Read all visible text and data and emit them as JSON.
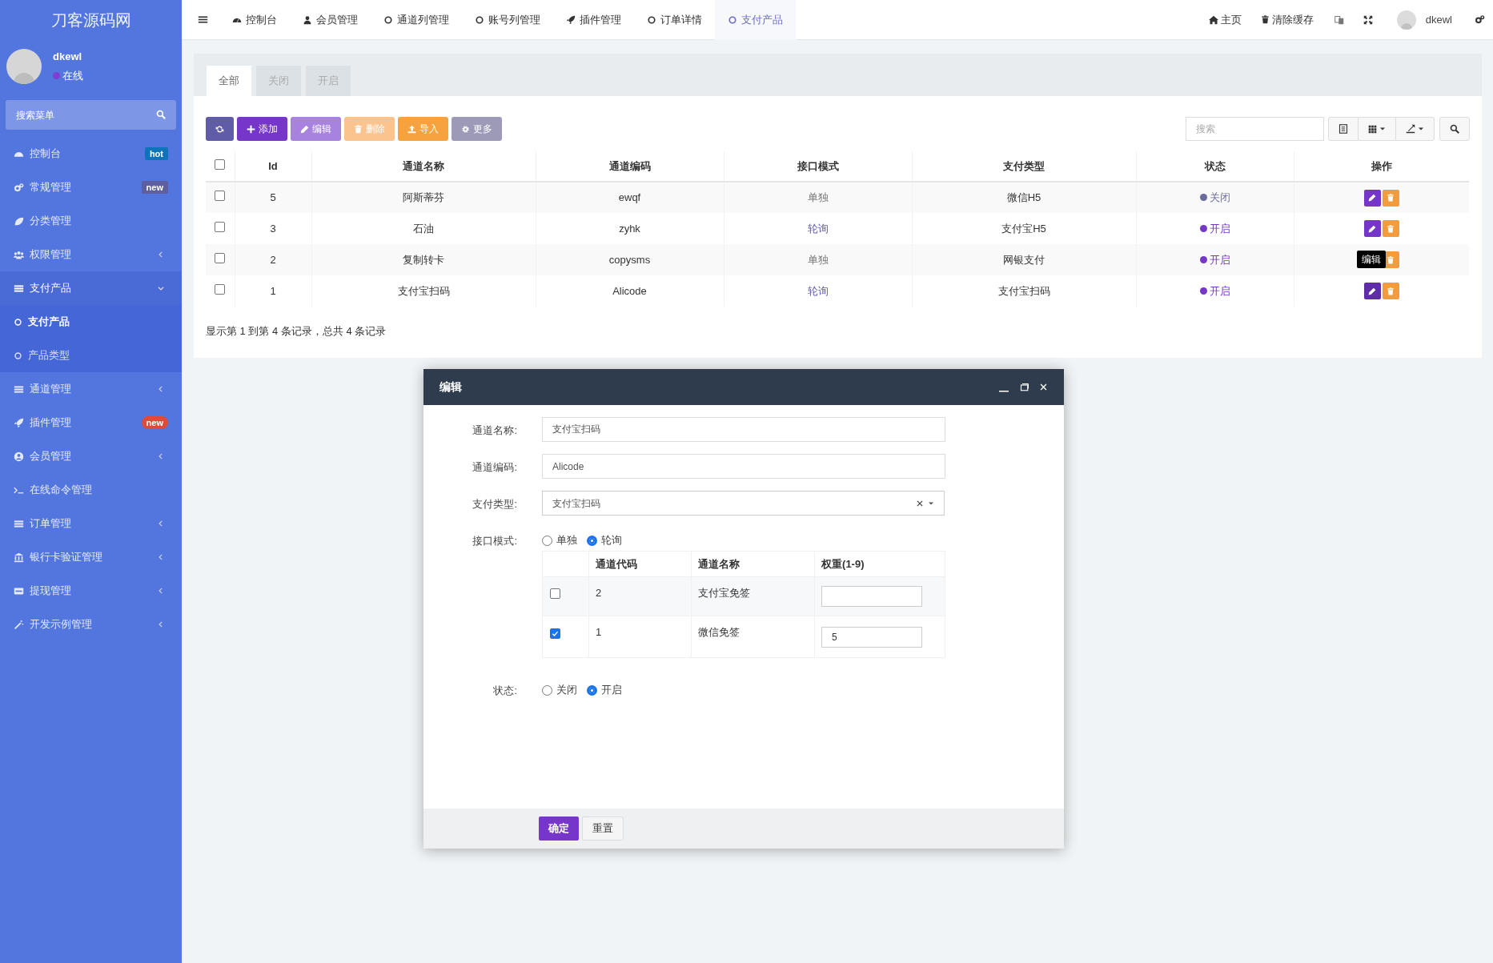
{
  "sidebar": {
    "logo": "刀客源码网",
    "user": {
      "name": "dkewl",
      "status": "在线",
      "online": true
    },
    "search": {
      "placeholder": "搜索菜单"
    },
    "items": [
      {
        "label": "控制台",
        "badge": {
          "text": "hot",
          "color": "#0e73b9"
        }
      },
      {
        "label": "常规管理",
        "badge": {
          "text": "new",
          "color": "#5d5f9e"
        }
      },
      {
        "label": "分类管理"
      },
      {
        "label": "权限管理",
        "expanded": false
      },
      {
        "label": "支付产品",
        "expanded": true,
        "children": [
          {
            "label": "支付产品",
            "selected": true
          },
          {
            "label": "产品类型",
            "selected": false
          }
        ]
      },
      {
        "label": "通道管理",
        "expanded": false
      },
      {
        "label": "插件管理",
        "badge": {
          "text": "new",
          "color": "#dd4b39"
        }
      },
      {
        "label": "会员管理",
        "expanded": false
      },
      {
        "label": "在线命令管理"
      },
      {
        "label": "订单管理",
        "expanded": false
      },
      {
        "label": "银行卡验证管理",
        "expanded": false
      },
      {
        "label": "提现管理",
        "expanded": false
      },
      {
        "label": "开发示例管理",
        "expanded": false
      }
    ]
  },
  "topnav": {
    "tabs": [
      {
        "label": "控制台",
        "selected": false
      },
      {
        "label": "会员管理",
        "selected": false
      },
      {
        "label": "通道列管理",
        "selected": false
      },
      {
        "label": "账号列管理",
        "selected": false
      },
      {
        "label": "插件管理",
        "selected": false
      },
      {
        "label": "订单详情",
        "selected": false
      },
      {
        "label": "支付产品",
        "selected": true
      }
    ],
    "home": "主页",
    "clear_cache": "清除缓存",
    "username": "dkewl"
  },
  "filter_tabs": [
    {
      "label": "全部",
      "selected": true
    },
    {
      "label": "关闭",
      "selected": false
    },
    {
      "label": "开启",
      "selected": false
    }
  ],
  "toolbar": {
    "buttons": [
      {
        "kind": "refresh",
        "disabled": false
      },
      {
        "kind": "add",
        "label": "添加",
        "disabled": false
      },
      {
        "kind": "edit",
        "label": "编辑",
        "disabled": true
      },
      {
        "kind": "delete",
        "label": "删除",
        "disabled": true
      },
      {
        "kind": "import",
        "label": "导入",
        "disabled": false
      },
      {
        "kind": "more",
        "label": "更多",
        "disabled": false
      }
    ],
    "search": {
      "placeholder": "搜索"
    }
  },
  "table": {
    "select_all_checked": false,
    "columns": [
      "Id",
      "通道名称",
      "通道编码",
      "接口模式",
      "支付类型",
      "状态",
      "操作"
    ],
    "rows": [
      {
        "checked": false,
        "id": "5",
        "name": "阿斯蒂芬",
        "code": "ewqf",
        "mode": {
          "text": "单独",
          "color": "#777777"
        },
        "pay_type": "微信H5",
        "status": {
          "text": "关闭",
          "color": "#6b6a9c"
        }
      },
      {
        "checked": false,
        "id": "3",
        "name": "石油",
        "code": "zyhk",
        "mode": {
          "text": "轮询",
          "color": "#605ca8"
        },
        "pay_type": "支付宝H5",
        "status": {
          "text": "开启",
          "color": "#7536c9"
        }
      },
      {
        "checked": false,
        "id": "2",
        "name": "复制转卡",
        "code": "copysms",
        "mode": {
          "text": "单独",
          "color": "#777777"
        },
        "pay_type": "网银支付",
        "status": {
          "text": "开启",
          "color": "#7536c9"
        }
      },
      {
        "checked": false,
        "id": "1",
        "name": "支付宝扫码",
        "code": "Alicode",
        "mode": {
          "text": "轮询",
          "color": "#605ca8"
        },
        "pay_type": "支付宝扫码",
        "status": {
          "text": "开启",
          "color": "#7536c9"
        },
        "tooltip": "编辑"
      }
    ],
    "footer": "显示第 1 到第 4 条记录，总共 4 条记录"
  },
  "dialog": {
    "title": "编辑",
    "fields": [
      {
        "kind": "text",
        "label": "通道名称:",
        "value": "支付宝扫码"
      },
      {
        "kind": "text",
        "label": "通道编码:",
        "value": "Alicode"
      },
      {
        "kind": "select",
        "label": "支付类型:",
        "value": "支付宝扫码"
      },
      {
        "kind": "radio",
        "label": "接口模式:",
        "options": [
          {
            "label": "单独",
            "selected": false
          },
          {
            "label": "轮询",
            "selected": true
          }
        ],
        "table": {
          "columns": [
            "通道代码",
            "通道名称",
            "权重(1-9)"
          ],
          "rows": [
            {
              "checked": false,
              "code": "2",
              "name": "支付宝免签"
            },
            {
              "checked": true,
              "code": "1",
              "name": "微信免签",
              "weight": "5"
            }
          ]
        }
      },
      {
        "kind": "radio",
        "label": "状态:",
        "options": [
          {
            "label": "关闭",
            "selected": false
          },
          {
            "label": "开启",
            "selected": true
          }
        ]
      }
    ],
    "buttons": [
      {
        "kind": "primary",
        "label": "确定"
      },
      {
        "kind": "default",
        "label": "重置"
      }
    ]
  }
}
